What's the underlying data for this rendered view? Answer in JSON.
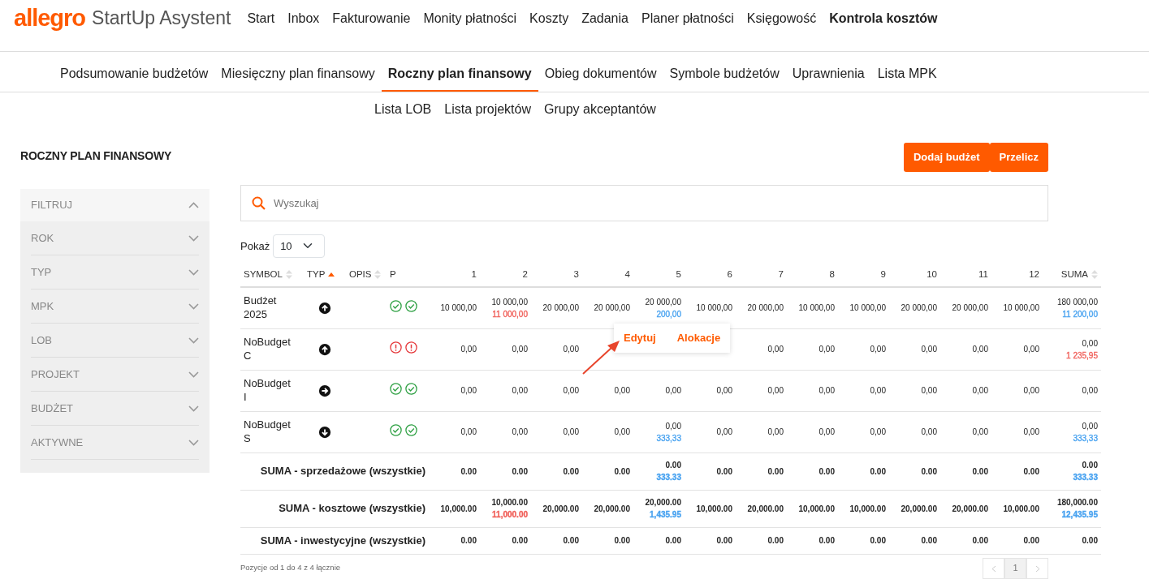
{
  "brand": {
    "logo": "allegro",
    "product": "StartUp Asystent"
  },
  "main_nav": [
    {
      "label": "Start",
      "selected": false
    },
    {
      "label": "Inbox",
      "selected": false
    },
    {
      "label": "Fakturowanie",
      "selected": false
    },
    {
      "label": "Monity płatności",
      "selected": false
    },
    {
      "label": "Koszty",
      "selected": false
    },
    {
      "label": "Zadania",
      "selected": false
    },
    {
      "label": "Planer płatności",
      "selected": false
    },
    {
      "label": "Księgowość",
      "selected": false
    },
    {
      "label": "Kontrola kosztów",
      "selected": true
    }
  ],
  "sub_nav": [
    {
      "label": "Podsumowanie budżetów",
      "selected": false
    },
    {
      "label": "Miesięczny plan finansowy",
      "selected": false
    },
    {
      "label": "Roczny plan finansowy",
      "selected": true
    },
    {
      "label": "Obieg dokumentów",
      "selected": false
    },
    {
      "label": "Symbole budżetów",
      "selected": false
    },
    {
      "label": "Uprawnienia",
      "selected": false
    },
    {
      "label": "Lista MPK",
      "selected": false
    }
  ],
  "sub_nav_2": [
    {
      "label": "Lista LOB",
      "selected": false
    },
    {
      "label": "Lista projektów",
      "selected": false
    },
    {
      "label": "Grupy akceptantów",
      "selected": false
    }
  ],
  "page_title": "ROCZNY PLAN FINANSOWY",
  "actions": [
    "Dodaj budżet",
    "Przelicz"
  ],
  "filter": {
    "title": "FILTRUJ",
    "expanded": true,
    "items": [
      {
        "label": "ROK",
        "expanded": false
      },
      {
        "label": "TYP",
        "expanded": false
      },
      {
        "label": "MPK",
        "expanded": false
      },
      {
        "label": "LOB",
        "expanded": false
      },
      {
        "label": "PROJEKT",
        "expanded": false
      },
      {
        "label": "BUDŻET",
        "expanded": false
      },
      {
        "label": "AKTYWNE",
        "expanded": false
      }
    ]
  },
  "search": {
    "placeholder": "Wyszukaj"
  },
  "page_size": {
    "label": "Pokaż",
    "value": "10"
  },
  "table": {
    "columns": [
      {
        "label": "SYMBOL",
        "sorted": false
      },
      {
        "label": "TYP",
        "sorted": true
      },
      {
        "label": "OPIS",
        "sorted": false
      },
      {
        "label": "P"
      },
      {
        "label": "1"
      },
      {
        "label": "2"
      },
      {
        "label": "3"
      },
      {
        "label": "4"
      },
      {
        "label": "5"
      },
      {
        "label": "6"
      },
      {
        "label": "7"
      },
      {
        "label": "8"
      },
      {
        "label": "9"
      },
      {
        "label": "10"
      },
      {
        "label": "11"
      },
      {
        "label": "12"
      },
      {
        "label": "SUMA",
        "sorted": false
      }
    ],
    "rows": [
      {
        "cells": [
          {
            "text": "Budżet 2025"
          },
          {
            "kind": "up"
          },
          "",
          {
            "approved": true
          },
          {
            "value": "10 000,00"
          },
          {
            "value": "10 000,00",
            "sub": "11 000,00",
            "color": "#f0605a"
          },
          {
            "value": "20 000,00"
          },
          {
            "value": "20 000,00"
          },
          {
            "value": "20 000,00",
            "sub": "200,00",
            "color": "#4aa3f0"
          },
          {
            "value": "10 000,00"
          },
          {
            "value": "20 000,00"
          },
          {
            "value": "10 000,00"
          },
          {
            "value": "10 000,00"
          },
          {
            "value": "20 000,00"
          },
          {
            "value": "20 000,00"
          },
          {
            "value": "10 000,00"
          },
          {
            "value": "180 000,00",
            "sub": "11 200,00",
            "color": "#4aa3f0"
          }
        ]
      },
      {
        "cells": [
          {
            "text": "NoBudget C"
          },
          {
            "kind": "up"
          },
          "",
          {
            "approved": false
          },
          {
            "value": "0,00"
          },
          {
            "value": "0,00"
          },
          {
            "value": "0,00"
          },
          null,
          null,
          null,
          {
            "value": "0,00"
          },
          {
            "value": "0,00"
          },
          {
            "value": "0,00"
          },
          {
            "value": "0,00"
          },
          {
            "value": "0,00"
          },
          {
            "value": "0,00"
          },
          {
            "value": "0,00",
            "sub": "1 235,95",
            "color": "#f0605a"
          }
        ]
      },
      {
        "cells": [
          {
            "text": "NoBudget I"
          },
          {
            "kind": "right"
          },
          "",
          {
            "approved": true
          },
          {
            "value": "0,00"
          },
          {
            "value": "0,00"
          },
          {
            "value": "0,00"
          },
          {
            "value": "0,00"
          },
          {
            "value": "0,00"
          },
          {
            "value": "0,00"
          },
          {
            "value": "0,00"
          },
          {
            "value": "0,00"
          },
          {
            "value": "0,00"
          },
          {
            "value": "0,00"
          },
          {
            "value": "0,00"
          },
          {
            "value": "0,00"
          },
          {
            "value": "0,00"
          }
        ]
      },
      {
        "cells": [
          {
            "text": "NoBudget S"
          },
          {
            "kind": "down"
          },
          "",
          {
            "approved": true
          },
          {
            "value": "0,00"
          },
          {
            "value": "0,00"
          },
          {
            "value": "0,00"
          },
          {
            "value": "0,00"
          },
          {
            "value": "0,00",
            "sub": "333,33",
            "color": "#4aa3f0"
          },
          {
            "value": "0,00"
          },
          {
            "value": "0,00"
          },
          {
            "value": "0,00"
          },
          {
            "value": "0,00"
          },
          {
            "value": "0,00"
          },
          {
            "value": "0,00"
          },
          {
            "value": "0,00"
          },
          {
            "value": "0,00",
            "sub": "333,33",
            "color": "#4aa3f0"
          }
        ]
      }
    ],
    "totals": [
      {
        "cells": [
          {
            "text": "SUMA - sprzedażowe (wszystkie)",
            "colspan": 4
          },
          {
            "value": "0.00"
          },
          {
            "value": "0.00"
          },
          {
            "value": "0.00"
          },
          {
            "value": "0.00"
          },
          {
            "value": "0.00",
            "sub": "333.33",
            "color": "#4aa3f0"
          },
          {
            "value": "0.00"
          },
          {
            "value": "0.00"
          },
          {
            "value": "0.00"
          },
          {
            "value": "0.00"
          },
          {
            "value": "0.00"
          },
          {
            "value": "0.00"
          },
          {
            "value": "0.00"
          },
          {
            "value": "0.00",
            "sub": "333.33",
            "color": "#4aa3f0"
          }
        ]
      },
      {
        "cells": [
          {
            "text": "SUMA - kosztowe (wszystkie)",
            "colspan": 4
          },
          {
            "value": "10,000.00"
          },
          {
            "value": "10,000.00",
            "sub": "11,000.00",
            "color": "#f0605a"
          },
          {
            "value": "20,000.00"
          },
          {
            "value": "20,000.00"
          },
          {
            "value": "20,000.00",
            "sub": "1,435.95",
            "color": "#4aa3f0"
          },
          {
            "value": "10,000.00"
          },
          {
            "value": "20,000.00"
          },
          {
            "value": "10,000.00"
          },
          {
            "value": "10,000.00"
          },
          {
            "value": "20,000.00"
          },
          {
            "value": "20,000.00"
          },
          {
            "value": "10,000.00"
          },
          {
            "value": "180,000.00",
            "sub": "12,435.95",
            "color": "#4aa3f0"
          }
        ]
      },
      {
        "cells": [
          {
            "text": "SUMA - inwestycyjne (wszystkie)",
            "colspan": 4
          },
          {
            "value": "0.00"
          },
          {
            "value": "0.00"
          },
          {
            "value": "0.00"
          },
          {
            "value": "0.00"
          },
          {
            "value": "0.00"
          },
          {
            "value": "0.00"
          },
          {
            "value": "0.00"
          },
          {
            "value": "0.00"
          },
          {
            "value": "0.00"
          },
          {
            "value": "0.00"
          },
          {
            "value": "0.00"
          },
          {
            "value": "0.00"
          },
          {
            "value": "0.00"
          }
        ]
      }
    ]
  },
  "row_menu": [
    "Edytuj",
    "Alokacje"
  ],
  "footer": "Pozycje od 1 do 4 z 4 łącznie",
  "pagination": {
    "pages": [
      {
        "label": "1",
        "selected": true
      }
    ],
    "prev_disabled": true,
    "next_disabled": true
  }
}
